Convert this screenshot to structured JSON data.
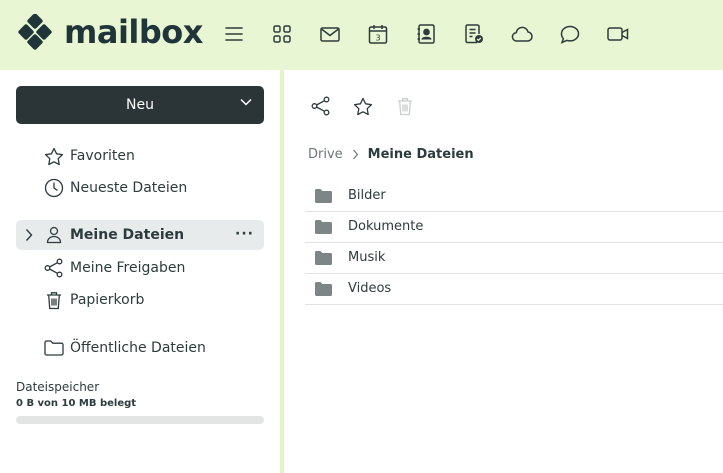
{
  "brand": {
    "name": "mailbox",
    "accent": "#7cc44b",
    "topbar_bg": "#e8f6d3",
    "dark": "#2b3436"
  },
  "topnav": [
    {
      "icon": "hamburger-menu-icon"
    },
    {
      "icon": "apps-grid-icon"
    },
    {
      "icon": "mail-icon"
    },
    {
      "icon": "calendar-icon",
      "badge": "3"
    },
    {
      "icon": "contacts-icon"
    },
    {
      "icon": "tasks-icon"
    },
    {
      "icon": "cloud-icon"
    },
    {
      "icon": "chat-icon"
    },
    {
      "icon": "video-icon"
    }
  ],
  "sidebar": {
    "new_label": "Neu",
    "items": [
      {
        "label": "Favoriten",
        "icon": "star-icon"
      },
      {
        "label": "Neueste Dateien",
        "icon": "clock-icon"
      },
      {
        "label": "Meine Dateien",
        "icon": "user-icon",
        "active": true,
        "more": "···"
      },
      {
        "label": "Meine Freigaben",
        "icon": "share-icon"
      },
      {
        "label": "Papierkorb",
        "icon": "trash-icon"
      },
      {
        "label": "Öffentliche Dateien",
        "icon": "folder-outline-icon"
      }
    ],
    "storage": {
      "title": "Dateispeicher",
      "usage": "0 B von 10 MB belegt",
      "used_fraction": 0
    }
  },
  "main": {
    "toolbar": [
      {
        "icon": "share-icon",
        "enabled": true
      },
      {
        "icon": "star-icon",
        "enabled": true
      },
      {
        "icon": "trash-icon",
        "enabled": false
      }
    ],
    "breadcrumb": {
      "root": "Drive",
      "current": "Meine Dateien"
    },
    "files": [
      {
        "name": "Bilder",
        "type": "folder"
      },
      {
        "name": "Dokumente",
        "type": "folder"
      },
      {
        "name": "Musik",
        "type": "folder"
      },
      {
        "name": "Videos",
        "type": "folder"
      }
    ]
  }
}
